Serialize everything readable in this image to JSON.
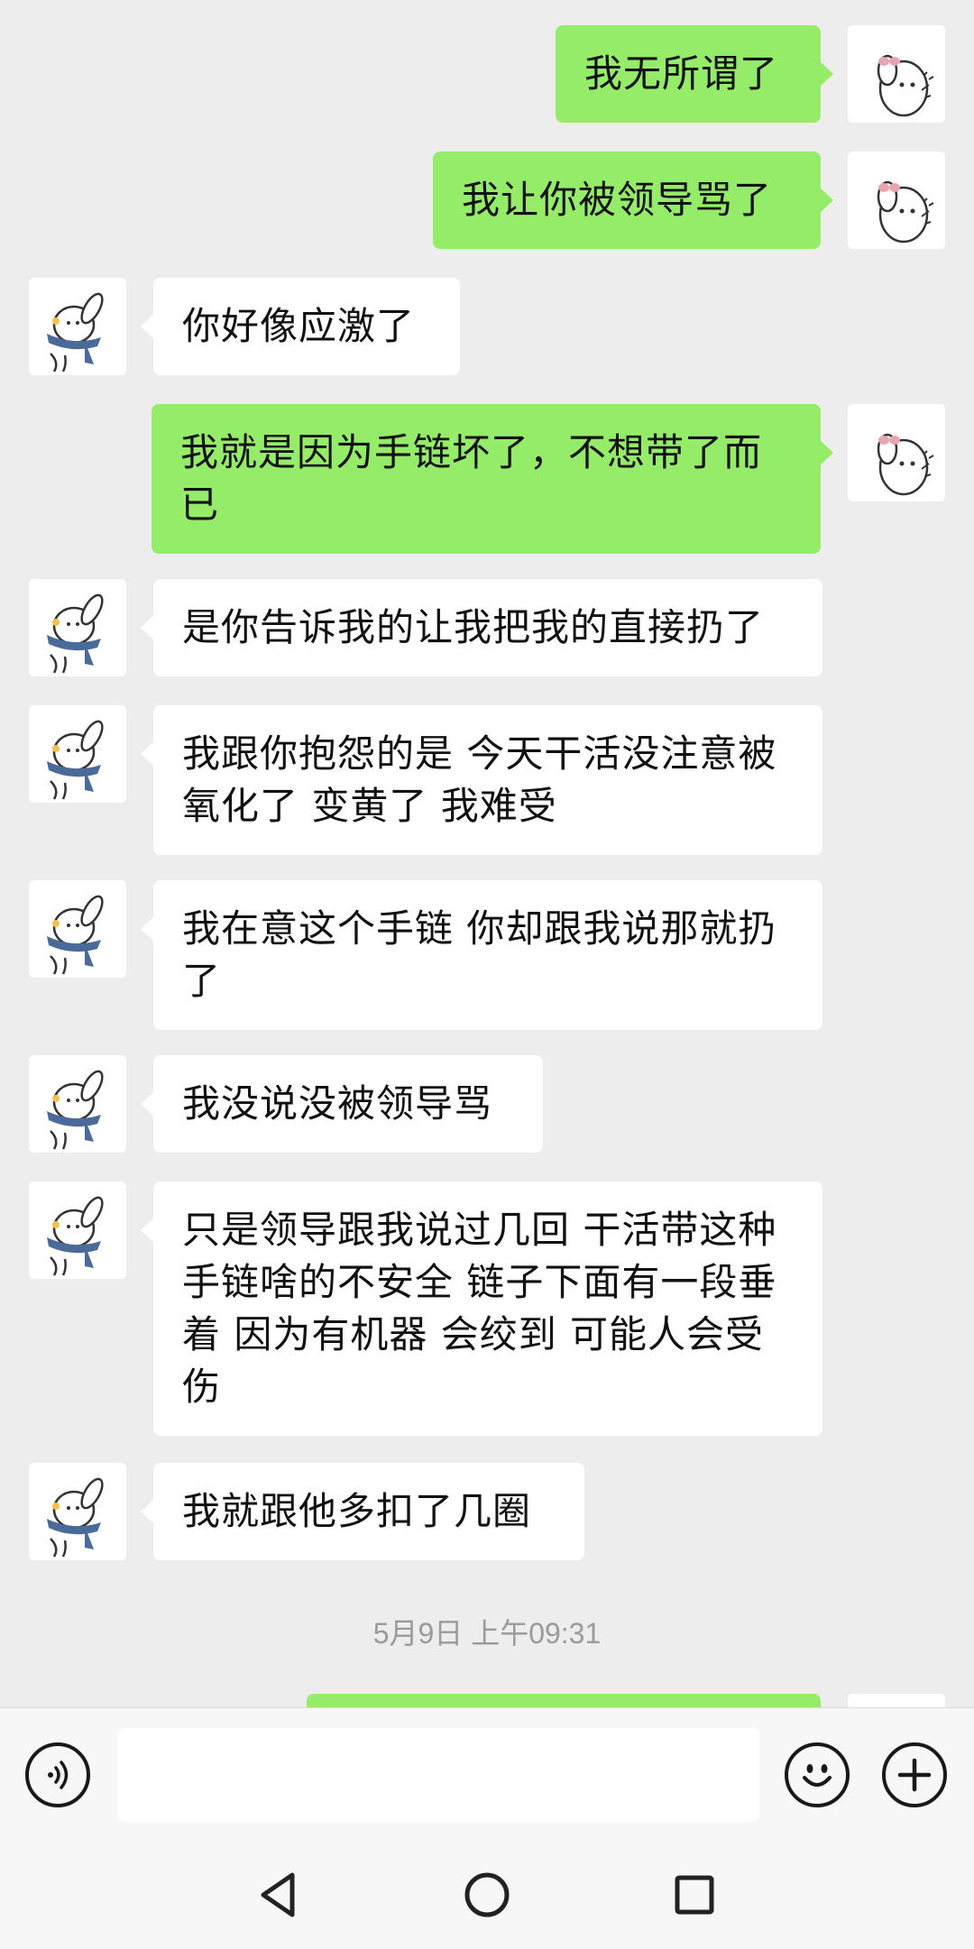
{
  "messages": [
    {
      "side": "me",
      "text": "我无所谓了"
    },
    {
      "side": "me",
      "text": "我让你被领导骂了"
    },
    {
      "side": "peer",
      "text": "你好像应激了"
    },
    {
      "side": "me",
      "text": "我就是因为手链坏了，不想带了而已"
    },
    {
      "side": "peer",
      "text": "是你告诉我的让我把我的直接扔了"
    },
    {
      "side": "peer",
      "text": "我跟你抱怨的是  今天干活没注意被氧化了 变黄了 我难受"
    },
    {
      "side": "peer",
      "text": "我在意这个手链  你却跟我说那就扔了"
    },
    {
      "side": "peer",
      "text": "我没说没被领导骂"
    },
    {
      "side": "peer",
      "text": "只是领导跟我说过几回 干活带这种手链啥的不安全  链子下面有一段垂着  因为有机器  会绞到  可能人会受伤"
    },
    {
      "side": "peer",
      "text": "我就跟他多扣了几圈"
    }
  ],
  "timestamp": "5月9日 上午09:31",
  "input": {
    "placeholder": ""
  },
  "icons": {
    "voice": "voice-input-icon",
    "emoji": "emoji-icon",
    "more": "plus-icon",
    "back": "back-triangle-icon",
    "home": "home-circle-icon",
    "recents": "recents-square-icon"
  },
  "colors": {
    "me_bubble": "#95ec69",
    "peer_bubble": "#ffffff",
    "background": "#ededed"
  }
}
